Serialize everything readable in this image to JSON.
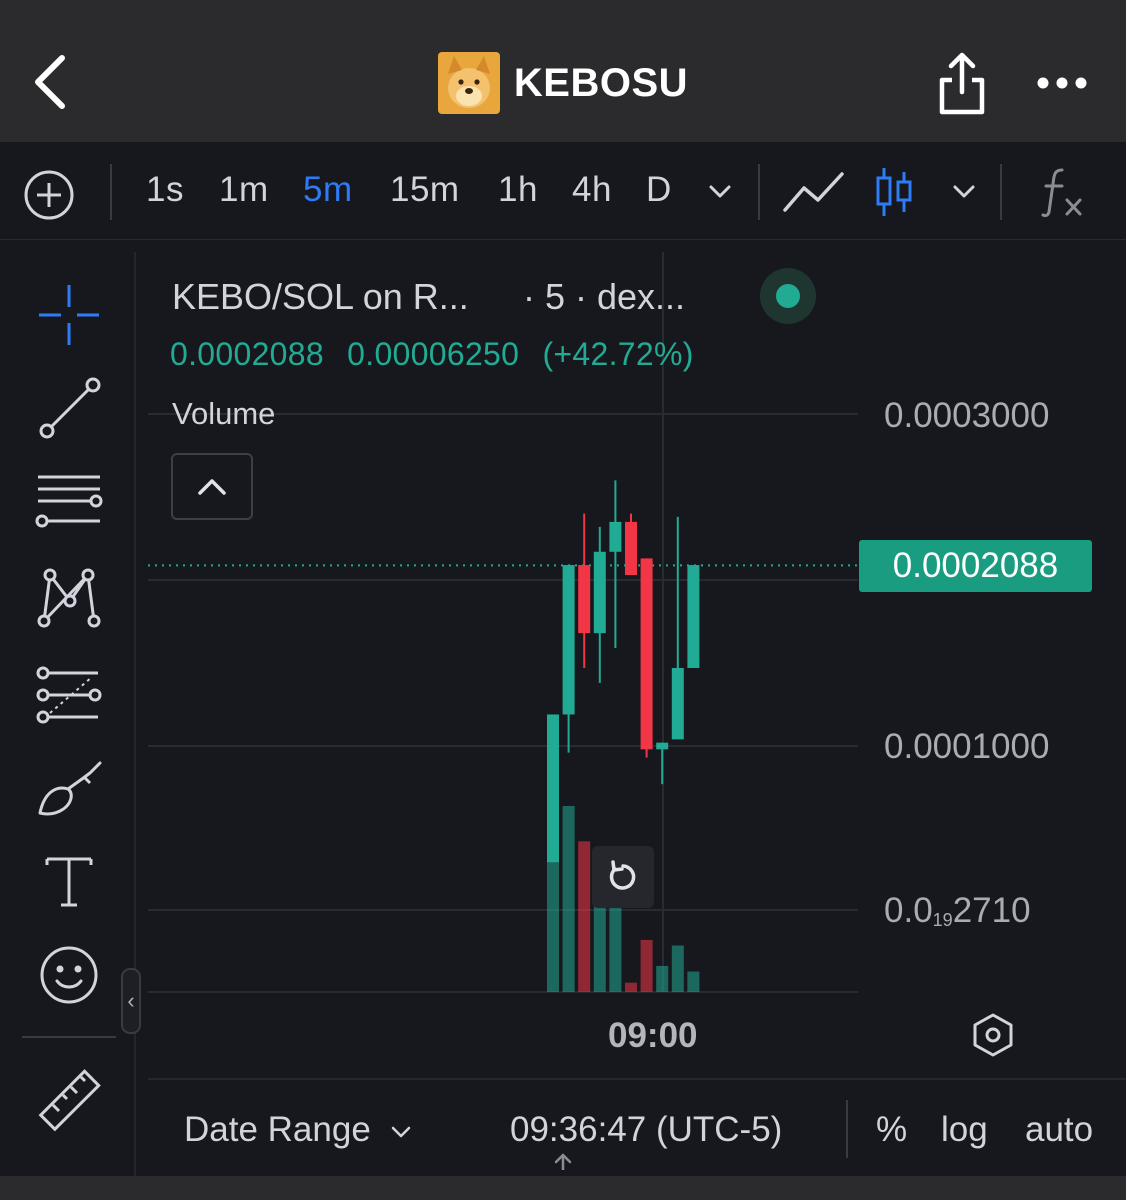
{
  "header": {
    "title": "KEBOSU",
    "icons": [
      "back-chevron-icon",
      "share-icon",
      "more-dots-icon"
    ]
  },
  "toolbar": {
    "intervals": [
      "1s",
      "1m",
      "5m",
      "15m",
      "1h",
      "4h",
      "D"
    ],
    "active_interval": "5m",
    "icons": [
      "add-circle-icon",
      "chevron-down-icon",
      "line-chart-icon",
      "candlestick-icon",
      "chevron-down-icon",
      "fx-indicator-icon"
    ],
    "accent_color": "#2e7bf6"
  },
  "drawing_tools": [
    "crosshair-icon",
    "trend-line-icon",
    "horizontal-lines-icon",
    "pattern-icon",
    "fib-icon",
    "brush-icon",
    "text-icon",
    "emoji-icon",
    "ruler-icon"
  ],
  "legend": {
    "symbol": "KEBO/SOL on R...",
    "meta": "· 5 · dex...",
    "last": "0.0002088",
    "change": "0.00006250",
    "change_pct": "(+42.72%)",
    "volume_label": "Volume",
    "status_color": "#22ab94"
  },
  "price_axis": {
    "labels": [
      "0.0003000",
      "0.0001000"
    ],
    "small_label_prefix": "0.0",
    "small_label_sub": "19",
    "small_label_suffix": "2710",
    "last_price_tag": "0.0002088",
    "last_price_color": "#1a9c80"
  },
  "time_axis": {
    "label": "09:00"
  },
  "chart_data": {
    "type": "candlestick",
    "ylim": [
      0,
      0.00032
    ],
    "up_color": "#22ab94",
    "down_color": "#f23645",
    "candles": [
      {
        "open": 3e-05,
        "high": 0.000119,
        "low": 3e-05,
        "close": 0.000119,
        "volume": 0.95
      },
      {
        "open": 0.000119,
        "high": 0.000209,
        "low": 9.6e-05,
        "close": 0.000209,
        "volume": 1.0
      },
      {
        "open": 0.000209,
        "high": 0.00024,
        "low": 0.000147,
        "close": 0.000168,
        "volume": 0.81
      },
      {
        "open": 0.000168,
        "high": 0.000232,
        "low": 0.000138,
        "close": 0.000217,
        "volume": 0.7
      },
      {
        "open": 0.000217,
        "high": 0.00026,
        "low": 0.000159,
        "close": 0.000235,
        "volume": 0.46
      },
      {
        "open": 0.000235,
        "high": 0.00024,
        "low": 0.000203,
        "close": 0.000203,
        "volume": 0.05
      },
      {
        "open": 0.000213,
        "high": 0.000213,
        "low": 9.3e-05,
        "close": 9.8e-05,
        "volume": 0.28
      },
      {
        "open": 9.8e-05,
        "high": 0.000102,
        "low": 7.7e-05,
        "close": 0.000102,
        "volume": 0.14
      },
      {
        "open": 0.000104,
        "high": 0.000238,
        "low": 0.000104,
        "close": 0.000147,
        "volume": 0.25
      },
      {
        "open": 0.000147,
        "high": 0.000209,
        "low": 0.000147,
        "close": 0.000209,
        "volume": 0.11
      }
    ]
  },
  "bottom_bar": {
    "date_range": "Date Range",
    "clock": "09:36:47 (UTC-5)",
    "percent": "%",
    "log": "log",
    "auto": "auto"
  }
}
